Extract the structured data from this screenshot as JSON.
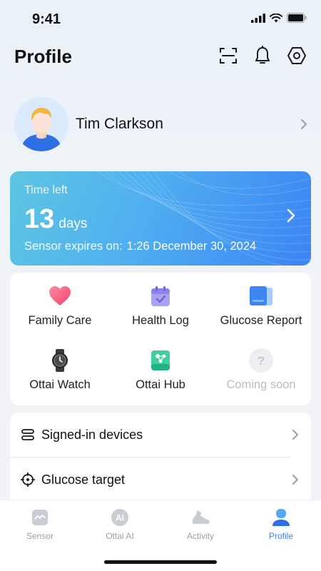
{
  "status_bar": {
    "time": "9:41"
  },
  "header": {
    "title": "Profile",
    "icons": [
      "scan-icon",
      "bell-icon",
      "settings-hex-icon"
    ]
  },
  "profile": {
    "name": "Tim Clarkson"
  },
  "sensor_card": {
    "time_left_label": "Time left",
    "days_value": "13",
    "days_unit": "days",
    "expires_label": "Sensor expires on:",
    "expires_value": "1:26 December 30, 2024"
  },
  "features": [
    {
      "label": "Family Care",
      "icon": "heart-icon"
    },
    {
      "label": "Health Log",
      "icon": "calendar-check-icon"
    },
    {
      "label": "Glucose Report",
      "icon": "report-icon"
    },
    {
      "label": "Ottai Watch",
      "icon": "watch-icon"
    },
    {
      "label": "Ottai Hub",
      "icon": "hub-icon"
    },
    {
      "label": "Coming soon",
      "icon": "question-icon"
    }
  ],
  "settings_list": [
    {
      "label": "Signed-in devices",
      "icon": "devices-icon"
    },
    {
      "label": "Glucose target",
      "icon": "target-icon"
    }
  ],
  "tabs": [
    {
      "label": "Sensor",
      "icon": "sensor-icon",
      "active": false
    },
    {
      "label": "Ottai AI",
      "icon": "ai-icon",
      "active": false
    },
    {
      "label": "Activity",
      "icon": "shoe-icon",
      "active": false
    },
    {
      "label": "Profile",
      "icon": "profile-icon",
      "active": true
    }
  ],
  "colors": {
    "accent": "#3a7ef0",
    "card_gradient_start": "#5ec6e3",
    "card_gradient_end": "#3b84f4",
    "inactive_tab": "#9aa0a8"
  }
}
